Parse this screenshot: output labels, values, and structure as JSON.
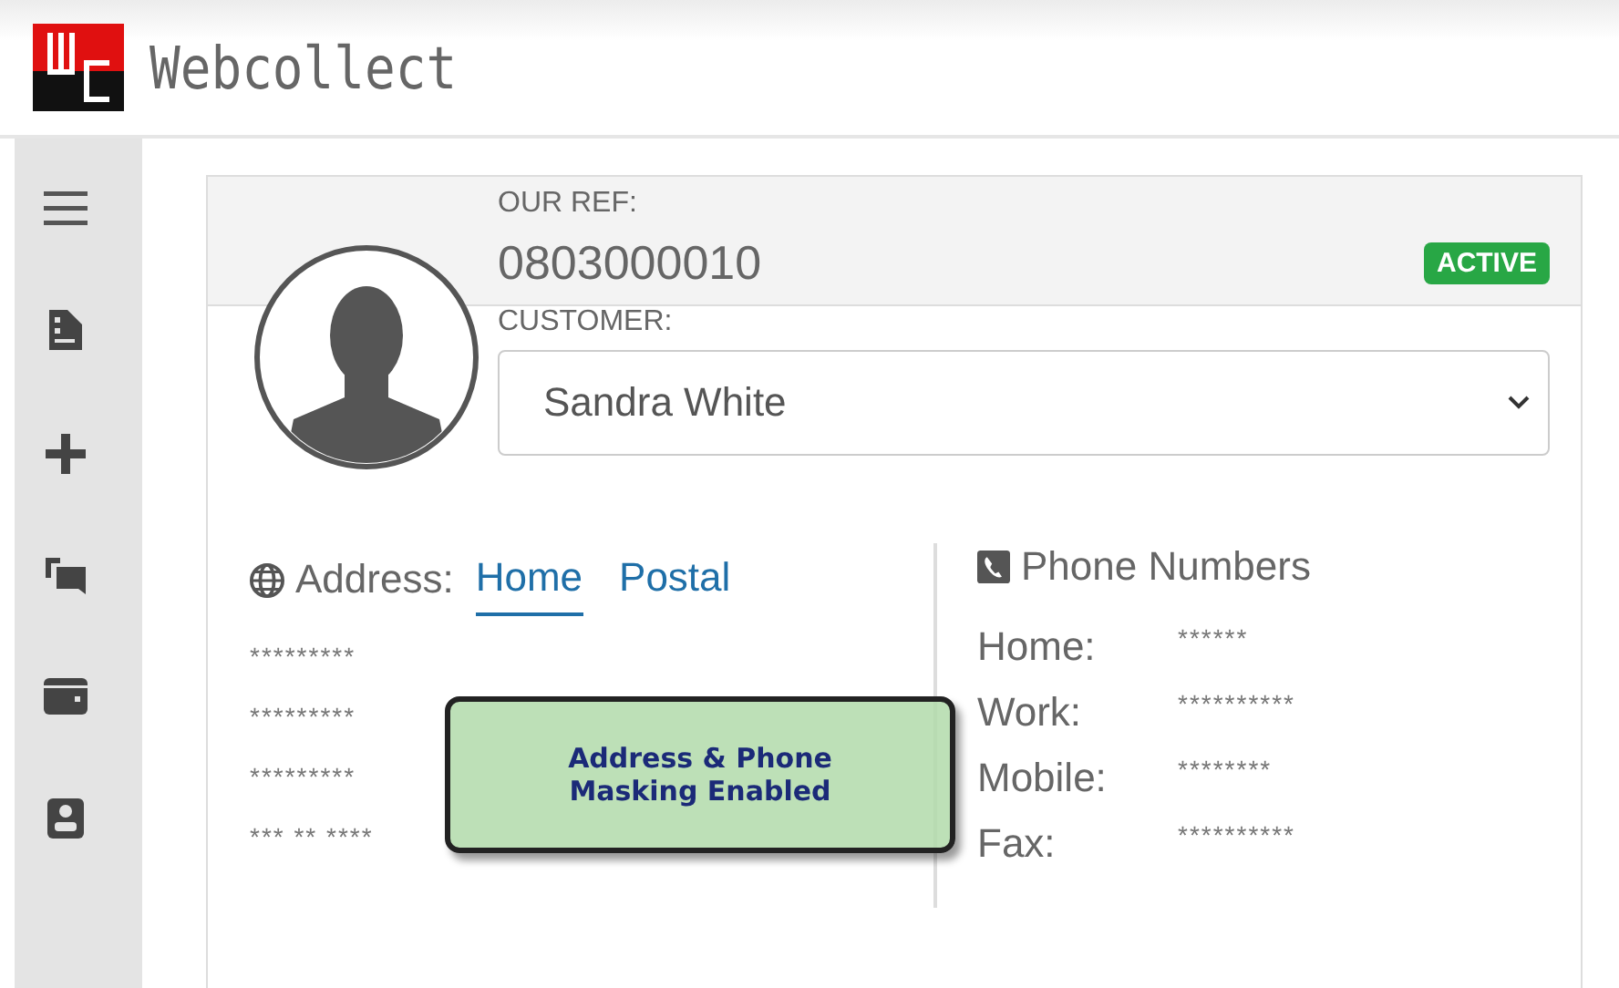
{
  "app": {
    "title": "Webcollect"
  },
  "record": {
    "ref_label": "OUR REF:",
    "ref_value": "0803000010",
    "status": "ACTIVE",
    "customer_label": "CUSTOMER:",
    "customer_value": "Sandra White"
  },
  "address": {
    "label": "Address:",
    "tabs": [
      {
        "label": "Home",
        "selected": true
      },
      {
        "label": "Postal",
        "selected": false
      }
    ],
    "lines": [
      "*********",
      "*********",
      "*********",
      "*** ** ****"
    ]
  },
  "phones": {
    "title": "Phone Numbers",
    "rows": [
      {
        "label": "Home:",
        "value": "******"
      },
      {
        "label": "Work:",
        "value": "**********"
      },
      {
        "label": "Mobile:",
        "value": "********"
      },
      {
        "label": "Fax:",
        "value": "**********"
      }
    ]
  },
  "callout": {
    "text": "Address & Phone Masking Enabled"
  }
}
